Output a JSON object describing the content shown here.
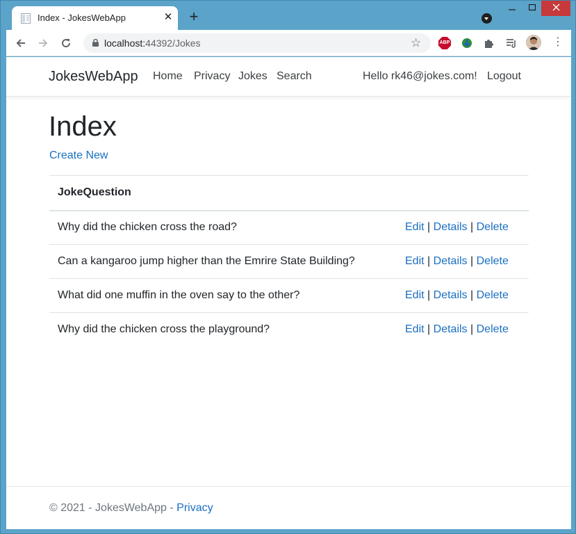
{
  "browser": {
    "tab_title": "Index - JokesWebApp",
    "url_host": "localhost:",
    "url_path": "44392/Jokes",
    "extension_abp_label": "ABP",
    "accent_close": "#c7393a"
  },
  "site": {
    "brand": "JokesWebApp",
    "nav": [
      "Home",
      "Privacy",
      "Jokes",
      "Search"
    ],
    "greeting": "Hello rk46@jokes.com!",
    "logout": "Logout"
  },
  "main": {
    "title": "Index",
    "create_new": "Create New",
    "table": {
      "header": "JokeQuestion",
      "rows": [
        "Why did the chicken cross the road?",
        "Can a kangaroo jump higher than the Emrire State Building?",
        "What did one muffin in the oven say to the other?",
        "Why did the chicken cross the playground?"
      ],
      "actions": {
        "edit": "Edit",
        "details": "Details",
        "delete": "Delete",
        "separator": "|"
      }
    }
  },
  "footer": {
    "copyright": "© 2021 - JokesWebApp - ",
    "privacy": "Privacy"
  },
  "colors": {
    "link": "#1a6fc2",
    "frame": "#5ba3c9"
  }
}
